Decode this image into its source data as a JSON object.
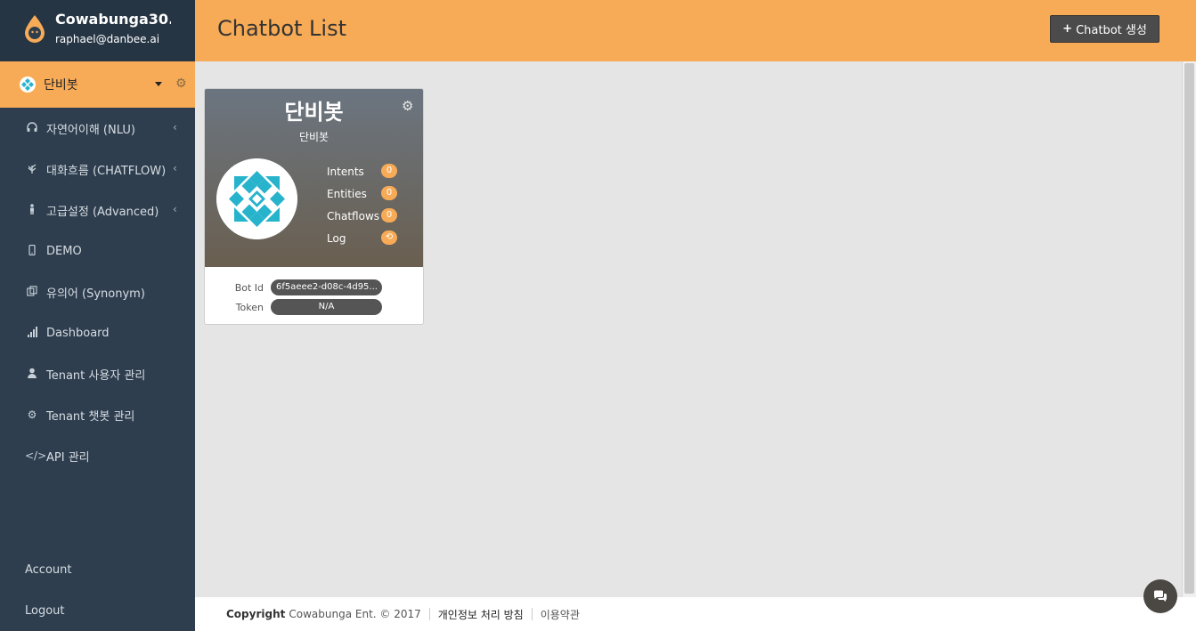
{
  "profile": {
    "name": "Cowabunga30...",
    "email": "raphael@danbee.ai"
  },
  "bot_selector": {
    "label": "단비봇"
  },
  "nav": [
    {
      "label": "자연어이해 (NLU)",
      "icon": "headset-icon",
      "has_chevron": true
    },
    {
      "label": "대화흐름 (CHATFLOW)",
      "icon": "plant-icon",
      "has_chevron": true
    },
    {
      "label": "고급설정 (Advanced)",
      "icon": "person-icon",
      "has_chevron": true
    },
    {
      "label": "DEMO",
      "icon": "mobile-icon",
      "has_chevron": false
    },
    {
      "label": "유의어 (Synonym)",
      "icon": "copy-icon",
      "has_chevron": false
    },
    {
      "label": "Dashboard",
      "icon": "bar-chart-icon",
      "has_chevron": false
    },
    {
      "label": "Tenant 사용자 관리",
      "icon": "user-icon",
      "has_chevron": false
    },
    {
      "label": "Tenant 챗봇 관리",
      "icon": "gear-icon",
      "has_chevron": false
    },
    {
      "label": "API 관리",
      "icon": "code-icon",
      "has_chevron": false
    }
  ],
  "nav_bottom": [
    {
      "label": "Account"
    },
    {
      "label": "Logout"
    }
  ],
  "header": {
    "title": "Chatbot List",
    "create_button": "Chatbot 생성"
  },
  "card": {
    "title": "단비봇",
    "subtitle": "단비봇",
    "stats": [
      {
        "label": "Intents",
        "badge": "0"
      },
      {
        "label": "Entities",
        "badge": "0"
      },
      {
        "label": "Chatflows",
        "badge": "0"
      },
      {
        "label": "Log",
        "badge": "⟲"
      }
    ],
    "bot_id_label": "Bot Id",
    "bot_id_value": "6f5aeee2-d08c-4d95...",
    "token_label": "Token",
    "token_value": "N/A"
  },
  "footer": {
    "copyright_bold": "Copyright",
    "copyright_text": "Cowabunga Ent. © 2017",
    "privacy": "개인정보 처리 방침",
    "terms": "이용약관"
  },
  "colors": {
    "accent": "#f7ab57",
    "sidebar": "#2e3e4e",
    "badge": "#f7ab57",
    "avatar_pattern": "#27b3cc"
  }
}
